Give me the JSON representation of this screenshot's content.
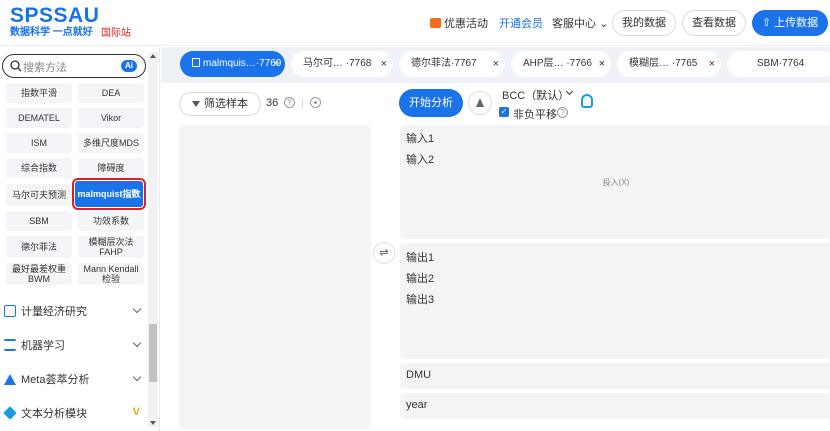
{
  "header": {
    "logo": "SPSSAU",
    "slogan": "数据科学 一点就好",
    "intl": "国际站",
    "nav": {
      "promo": "优惠活动",
      "member": "开通会员",
      "service": "客服中心",
      "service_chev": "⌄"
    },
    "my_data": "我的数据",
    "view_data": "查看数据",
    "upload": "上传数据",
    "upload_icon": "⇧"
  },
  "sidebar": {
    "search_placeholder": "搜索方法",
    "ai_badge": "Ai",
    "methods": [
      "指数平滑",
      "DEA",
      "DEMATEL",
      "Vikor",
      "ISM",
      "多维尺度MDS",
      "综合指数",
      "障碍度",
      "马尔可夫预测",
      "malmquist指数",
      "SBM",
      "功效系数",
      "德尔菲法",
      "模糊层次法FAHP",
      "最好最差权重BWM",
      "Mann Kendall检验"
    ],
    "active_method": "malmquist指数",
    "categories": [
      "计量经济研究",
      "机器学习",
      "Meta荟萃分析",
      "文本分析模块"
    ]
  },
  "tabs": [
    {
      "label": "malmquis…·7769",
      "active": true
    },
    {
      "label": "马尔可…  ·7768",
      "active": false
    },
    {
      "label": "德尔菲法·7767",
      "active": false
    },
    {
      "label": "AHP层… ·7766",
      "active": false
    },
    {
      "label": "模糊层… ·7765",
      "active": false
    },
    {
      "label": "SBM·7764",
      "active": false
    }
  ],
  "tab_close": "×",
  "main": {
    "filter_label": "筛选样本",
    "sample_count": "36",
    "help": "?",
    "swap": "⇌",
    "start": "开始分析",
    "model": "BCC（默认）",
    "nonneg_label": "非负平移",
    "checkmark": "✓",
    "input_vars": [
      "输入1",
      "输入2"
    ],
    "input_drop": "投入(X)",
    "output_vars": [
      "输出1",
      "输出2",
      "输出3"
    ],
    "dmu": "DMU",
    "year": "year"
  },
  "colors": {
    "accent": "#1a73e8",
    "highlight": "#e02020",
    "panel": "#f3f4f6"
  }
}
